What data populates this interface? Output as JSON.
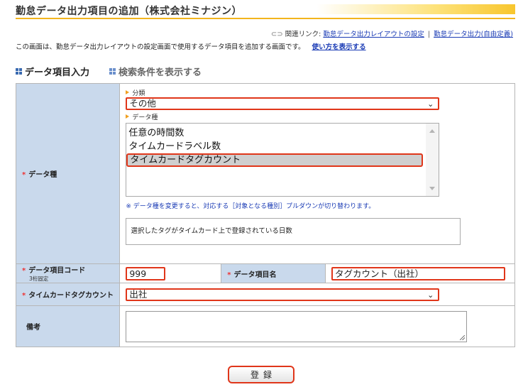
{
  "header": {
    "title": "勤怠データ出力項目の追加（株式会社ミナジン）",
    "related_links_label": "関連リンク:",
    "related_links": [
      "勤怠データ出力レイアウトの設定",
      "勤怠データ出力(自由定義)"
    ],
    "description": "この画面は、勤怠データ出力レイアウトの設定画面で使用するデータ項目を追加する画面です。",
    "help_link": "使い方を表示する"
  },
  "tabs": [
    {
      "label": "データ項目入力",
      "active": true
    },
    {
      "label": "検索条件を表示する",
      "active": false
    }
  ],
  "form": {
    "data_type": {
      "label": "データ種",
      "category_label": "分類",
      "category_value": "その他",
      "type_label": "データ種",
      "options": [
        "任意の時間数",
        "タイムカードラベル数",
        "タイムカードタグカウント"
      ],
      "selected_index": 2,
      "note": "※ データ種を変更すると、対応する［対象となる種別］プルダウンが切り替わります。",
      "description": "選択したタグがタイムカード上で登録されている日数"
    },
    "item_code": {
      "label": "データ項目コード",
      "sub": "3桁固定",
      "value": "999"
    },
    "item_name": {
      "label": "データ項目名",
      "value": "タグカウント（出社）"
    },
    "timecard_tag": {
      "label": "タイムカードタグカウント",
      "value": "出社"
    },
    "memo": {
      "label": "備考",
      "value": ""
    },
    "required_mark": "*",
    "submit_label": "登録"
  },
  "icons": {
    "link": "link-icon",
    "dropdown": "chevron-down-icon",
    "tab": "grid-icon"
  },
  "colors": {
    "accent_highlight": "#e0361a",
    "label_bg": "#c9d9ec",
    "link": "#1a3bb5",
    "title_gradient": "#f8c62e"
  }
}
